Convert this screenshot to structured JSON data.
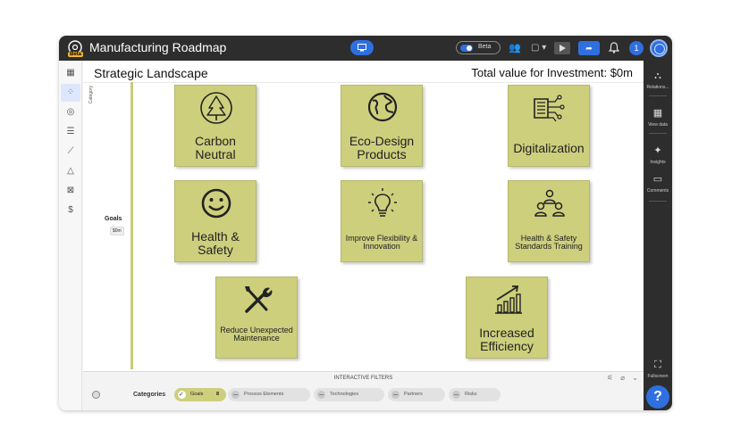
{
  "header": {
    "title": "Manufacturing Roadmap",
    "beta_tag": "Beta",
    "beta_toggle_label": "Beta",
    "notification_count": "1"
  },
  "canvas": {
    "title": "Strategic Landscape",
    "total": "Total value for Investment: $0m",
    "category_label": "Category",
    "lane": {
      "label": "Goals",
      "value": "$0m"
    }
  },
  "cards": [
    {
      "label": "Carbon Neutral",
      "icon": "tree-icon"
    },
    {
      "label": "Eco-Design Products",
      "icon": "globe-icon"
    },
    {
      "label": "Digitalization",
      "icon": "digital-book-icon"
    },
    {
      "label": "Health & Safety",
      "icon": "smiley-icon"
    },
    {
      "label": "Improve Flexibility & Innovation",
      "icon": "lightbulb-icon"
    },
    {
      "label": "Health & Safety Standards Training",
      "icon": "team-icon"
    },
    {
      "label": "Reduce Unexpected Maintenance",
      "icon": "tools-icon"
    },
    {
      "label": "Increased Efficiency",
      "icon": "growth-chart-icon"
    }
  ],
  "right_rail": {
    "relations": "Relations...",
    "view_data": "View data",
    "insights": "Insights",
    "comments": "Comments",
    "fullscreen": "Fullscreen",
    "help": "?"
  },
  "filters": {
    "title": "INTERACTIVE FILTERS",
    "categories_label": "Categories",
    "chips": [
      {
        "label": "Goals",
        "count": "8",
        "active": true
      },
      {
        "label": "Process Elements",
        "active": false
      },
      {
        "label": "Technologies",
        "active": false
      },
      {
        "label": "Partners",
        "active": false
      },
      {
        "label": "Risks",
        "active": false
      }
    ]
  },
  "colors": {
    "header_bg": "#2d2d2d",
    "accent": "#2f6fe0",
    "card_fill": "#cdcf7d",
    "lane_bar": "#c5cc76"
  }
}
